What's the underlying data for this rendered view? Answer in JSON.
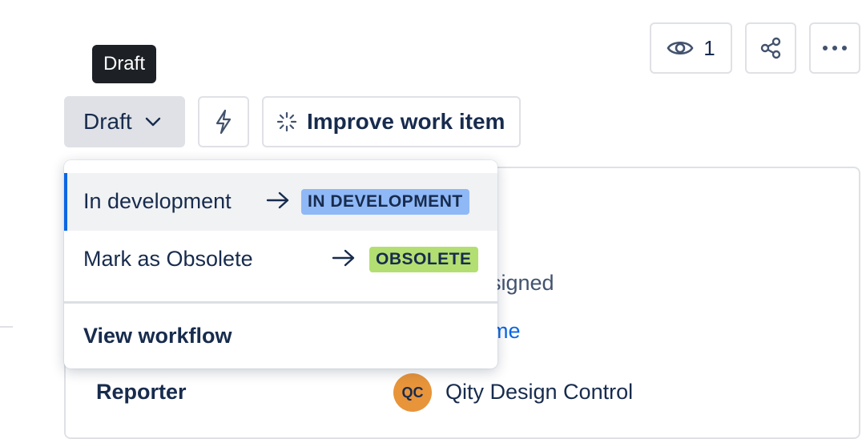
{
  "header": {
    "watchers_count": "1"
  },
  "tooltip": {
    "text": "Draft"
  },
  "toolbar": {
    "status_label": "Draft",
    "improve_label": "Improve work item"
  },
  "details": {
    "assignee_value_partial": "signed",
    "assign_to_me_partial": "me",
    "reporter_label": "Reporter",
    "reporter_initials": "QC",
    "reporter_name": "Qity Design Control"
  },
  "menu": {
    "transitions": [
      {
        "label": "In development",
        "arrow": "→",
        "target": "IN DEVELOPMENT",
        "target_color": "#8fb8f6"
      },
      {
        "label": "Mark as Obsolete",
        "arrow": "→",
        "target": "OBSOLETE",
        "target_color": "#b3df72"
      }
    ],
    "footer_label": "View workflow"
  },
  "colors": {
    "accent": "#0c66e4",
    "avatar": "#e8943a",
    "tooltip_bg": "#1d2125"
  }
}
